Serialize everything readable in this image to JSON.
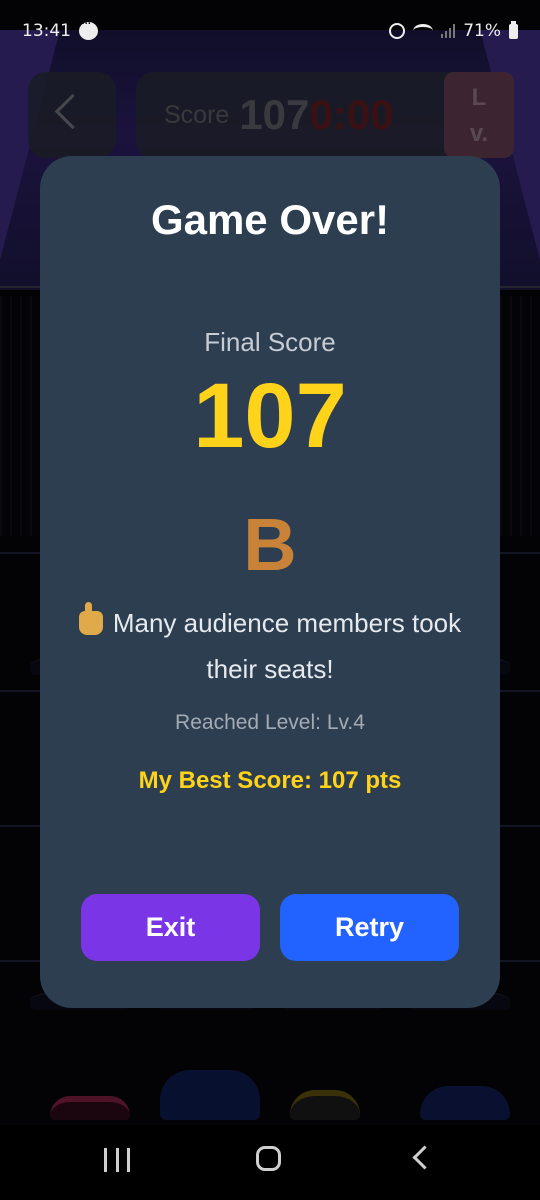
{
  "status_bar": {
    "time": "13:41",
    "battery": "71%"
  },
  "hud": {
    "score_label": "Score",
    "score_value": "107",
    "timer": "0:00",
    "level_chip": "L\nv."
  },
  "modal": {
    "title": "Game Over!",
    "final_score_label": "Final Score",
    "final_score_value": "107",
    "grade": "B",
    "message": "Many audience members took their seats!",
    "reached_level": "Reached Level: Lv.4",
    "best_score": "My Best Score: 107 pts",
    "exit_label": "Exit",
    "retry_label": "Retry"
  },
  "colors": {
    "modal_bg": "#2c3e50",
    "score_yellow": "#ffd31a",
    "grade_orange": "#c98339",
    "exit_purple": "#7a35e6",
    "retry_blue": "#2262ff"
  },
  "icons": {
    "message_prefix": "thumbs-up-icon",
    "status_left": "chat-bubble-icon",
    "status_right": [
      "alarm-icon",
      "wifi-icon",
      "signal-icon",
      "battery-icon"
    ],
    "nav": [
      "recent-apps-icon",
      "home-icon",
      "back-icon"
    ]
  }
}
